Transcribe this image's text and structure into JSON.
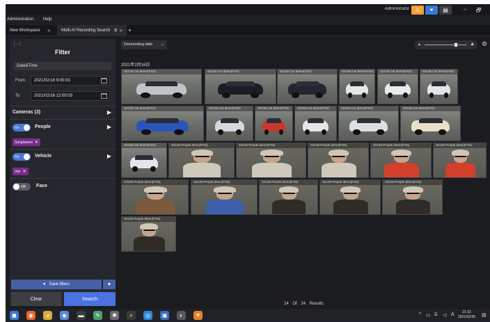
{
  "titlebar": {
    "user": "Administrator",
    "minimize": "–",
    "restore": "🗗"
  },
  "menu": [
    "Administration",
    "Help"
  ],
  "tabs": [
    {
      "label": "New Workspace",
      "close": "✕"
    },
    {
      "label": "Multi-AI Recording Search",
      "popout": "⧉",
      "close": "✕"
    }
  ],
  "tab_add": "+",
  "sidebar": {
    "collapse_icon": "|←|",
    "title": "Filter",
    "datetime_section": "Date&Time",
    "from_label": "From",
    "from_value": "2021/02/16 9:00:03",
    "to_label": "To",
    "to_value": "2021/02/16 12:00:03",
    "cameras_label": "Cameras (3)",
    "people": {
      "toggle_text": "On",
      "label": "People",
      "chip": "Sunglasses"
    },
    "vehicle": {
      "toggle_text": "On",
      "label": "Vehicle",
      "chip": "Van"
    },
    "face": {
      "toggle_text": "Off",
      "label": "Face"
    },
    "chevron": "▶",
    "chip_close": "✕",
    "save_filters": "Save filters",
    "save_heart": "♥",
    "save_caret": "▼",
    "clear": "Clear",
    "search": "Search"
  },
  "main": {
    "sort": "Descending date",
    "sort_caret": "⌄",
    "zoom_small": "▲",
    "zoom_large": "▲",
    "gear": "⚙",
    "date_group": "2021年2月16日",
    "results": {
      "count": "24",
      "of": "Of",
      "total": "24",
      "label": "Results"
    }
  },
  "thumbnails": [
    {
      "kind": "car",
      "caption": "S2136 Car demo(FSS)",
      "color": "#c0c4c6"
    },
    {
      "kind": "car",
      "caption": "S2136 Car demo(FSS)",
      "color": "#1a1d24"
    },
    {
      "kind": "car",
      "caption": "S2136 Car demo(FSS)",
      "color": "#22262e"
    },
    {
      "kind": "car",
      "caption": "S2136 Car demo(FSS)",
      "color": "#e4e6e8"
    },
    {
      "kind": "car",
      "caption": "S2136 Car demo(FSS)",
      "color": "#e8eaec"
    },
    {
      "kind": "car",
      "caption": "S2136 Car demo(FSS)",
      "color": "#e2e4e6"
    },
    {
      "kind": "car",
      "caption": "S2136 Car demo(FSS)",
      "color": "#2a55b8"
    },
    {
      "kind": "car",
      "caption": "S2136 Car demo(FSS)",
      "color": "#d6d8dc"
    },
    {
      "kind": "car",
      "caption": "S2136 Car demo(FSS)",
      "color": "#c8372e"
    },
    {
      "kind": "car",
      "caption": "S2136 Car demo(FSS)",
      "color": "#e6e6e8"
    },
    {
      "kind": "car",
      "caption": "S2136 Car demo(FSS)",
      "color": "#dcdee0"
    },
    {
      "kind": "car",
      "caption": "S2136 Car demo(FSS)",
      "color": "#e9e0c8"
    },
    {
      "kind": "car",
      "caption": "S2136 Car demo(FSS)",
      "color": "#e4e6ea"
    },
    {
      "kind": "person",
      "caption": "S2136 People demo(FSS)",
      "color": "#cfc9bc"
    },
    {
      "kind": "person",
      "caption": "S2136 People demo(FSS)",
      "color": "#cfc9bc"
    },
    {
      "kind": "person",
      "caption": "S2136 People demo(FSS)",
      "color": "#cfc9bc"
    },
    {
      "kind": "person",
      "caption": "S2136 People demo(FSS)",
      "color": "#d2402c"
    },
    {
      "kind": "person",
      "caption": "S2136 People demo(FSS)",
      "color": "#d2402c"
    },
    {
      "kind": "person",
      "caption": "S2136 People demo(FSS)",
      "color": "#7e5a3c"
    },
    {
      "kind": "person",
      "caption": "S2136 People demo(FSS)",
      "color": "#3f5fae"
    },
    {
      "kind": "person",
      "caption": "S2136 People demo(FSS)",
      "color": "#2f2c28"
    },
    {
      "kind": "person",
      "caption": "S2136 People demo(FSS)",
      "color": "#2f2c28"
    },
    {
      "kind": "person",
      "caption": "S2136 People demo(FSS)",
      "color": "#2f2c28"
    },
    {
      "kind": "person",
      "caption": "S2136 People demo(FSS)",
      "color": "#2f2c28"
    }
  ],
  "taskbar": {
    "apps": [
      {
        "name": "windows-start-icon",
        "glyph": "◼",
        "color": "#3a7bd5"
      },
      {
        "name": "firefox-icon",
        "glyph": "◉",
        "color": "#e8642c"
      },
      {
        "name": "chrome-icon",
        "glyph": "◕",
        "color": "#d9a93a"
      },
      {
        "name": "app-icon",
        "glyph": "◆",
        "color": "#5a8bd8"
      },
      {
        "name": "terminal-icon",
        "glyph": "▬",
        "color": "#3c3c3c"
      },
      {
        "name": "paint-icon",
        "glyph": "✎",
        "color": "#4aa06a"
      },
      {
        "name": "settings-icon",
        "glyph": "✱",
        "color": "#6a6a6a"
      },
      {
        "name": "search-tool-icon",
        "glyph": "⌕",
        "color": "#3a3a3a"
      },
      {
        "name": "camera-icon",
        "glyph": "◎",
        "color": "#2a88d8"
      },
      {
        "name": "monitor-icon",
        "glyph": "▣",
        "color": "#3a6ab8"
      },
      {
        "name": "media-icon",
        "glyph": "◐",
        "color": "#5a5a5a"
      },
      {
        "name": "vms-icon",
        "glyph": "▼",
        "color": "#e6822a"
      }
    ],
    "tray_caret": "^",
    "tray_lang": "A",
    "time": "21:31",
    "date": "2021/02/26"
  },
  "colors": {
    "accent": "#4a72e0",
    "chip": "#7a2b8e",
    "titlebar_orange": "#f0a23a",
    "titlebar_blue": "#3a7bd5"
  }
}
